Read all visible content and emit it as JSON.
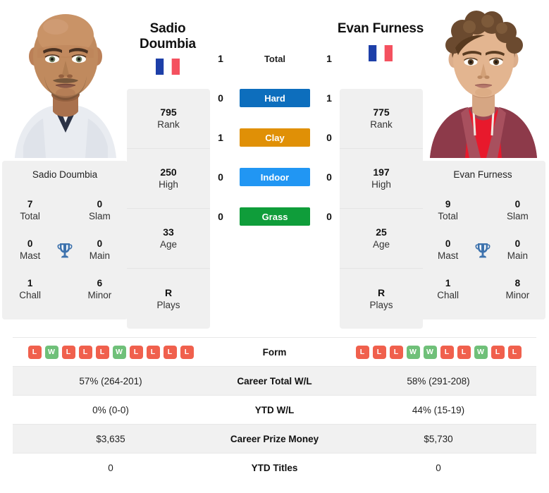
{
  "players": {
    "left": {
      "name_line1": "Sadio",
      "name_line2": "Doumbia",
      "full_name": "Sadio Doumbia",
      "flag": "france-flag-icon",
      "photo": "player-photo-sadio-doumbia",
      "stats": [
        {
          "value": "795",
          "label": "Rank"
        },
        {
          "value": "250",
          "label": "High"
        },
        {
          "value": "33",
          "label": "Age"
        },
        {
          "value": "R",
          "label": "Plays"
        }
      ],
      "titles": [
        {
          "value": "7",
          "label": "Total"
        },
        {
          "value": "0",
          "label": "Slam"
        },
        {
          "value": "0",
          "label": "Mast"
        },
        {
          "value": "0",
          "label": "Main"
        },
        {
          "value": "1",
          "label": "Chall"
        },
        {
          "value": "6",
          "label": "Minor"
        }
      ],
      "form": [
        "L",
        "W",
        "L",
        "L",
        "L",
        "W",
        "L",
        "L",
        "L",
        "L"
      ],
      "career_total_wl": "57% (264-201)",
      "ytd_wl": "0% (0-0)",
      "career_prize_money": "$3,635",
      "ytd_titles": "0"
    },
    "right": {
      "name_line1": "Evan Furness",
      "name_line2": "",
      "full_name": "Evan Furness",
      "flag": "france-flag-icon",
      "photo": "player-photo-evan-furness",
      "stats": [
        {
          "value": "775",
          "label": "Rank"
        },
        {
          "value": "197",
          "label": "High"
        },
        {
          "value": "25",
          "label": "Age"
        },
        {
          "value": "R",
          "label": "Plays"
        }
      ],
      "titles": [
        {
          "value": "9",
          "label": "Total"
        },
        {
          "value": "0",
          "label": "Slam"
        },
        {
          "value": "0",
          "label": "Mast"
        },
        {
          "value": "0",
          "label": "Main"
        },
        {
          "value": "1",
          "label": "Chall"
        },
        {
          "value": "8",
          "label": "Minor"
        }
      ],
      "form": [
        "L",
        "L",
        "L",
        "W",
        "W",
        "L",
        "L",
        "W",
        "L",
        "L"
      ],
      "career_total_wl": "58% (291-208)",
      "ytd_wl": "44% (15-19)",
      "career_prize_money": "$5,730",
      "ytd_titles": "0"
    }
  },
  "head_to_head": [
    {
      "surface": "Total",
      "left": "1",
      "right": "1",
      "color": "transparent"
    },
    {
      "surface": "Hard",
      "left": "0",
      "right": "1",
      "color": "#0d6ebd"
    },
    {
      "surface": "Clay",
      "left": "1",
      "right": "0",
      "color": "#e09006"
    },
    {
      "surface": "Indoor",
      "left": "0",
      "right": "0",
      "color": "#2196f3"
    },
    {
      "surface": "Grass",
      "left": "0",
      "right": "0",
      "color": "#0f9d3a"
    }
  ],
  "comparison_rows": [
    {
      "label": "Form"
    },
    {
      "label": "Career Total W/L"
    },
    {
      "label": "YTD W/L"
    },
    {
      "label": "Career Prize Money"
    },
    {
      "label": "YTD Titles"
    }
  ],
  "icons": {
    "trophy": "trophy-icon"
  },
  "colors": {
    "hard": "#0d6ebd",
    "clay": "#e09006",
    "indoor": "#2196f3",
    "grass": "#0f9d3a",
    "win_badge": "#6fc079",
    "loss_badge": "#f0604d",
    "trophy": "#3d72ad",
    "panel_bg": "#f0f0f0",
    "row_shaded": "#f1f1f1"
  }
}
